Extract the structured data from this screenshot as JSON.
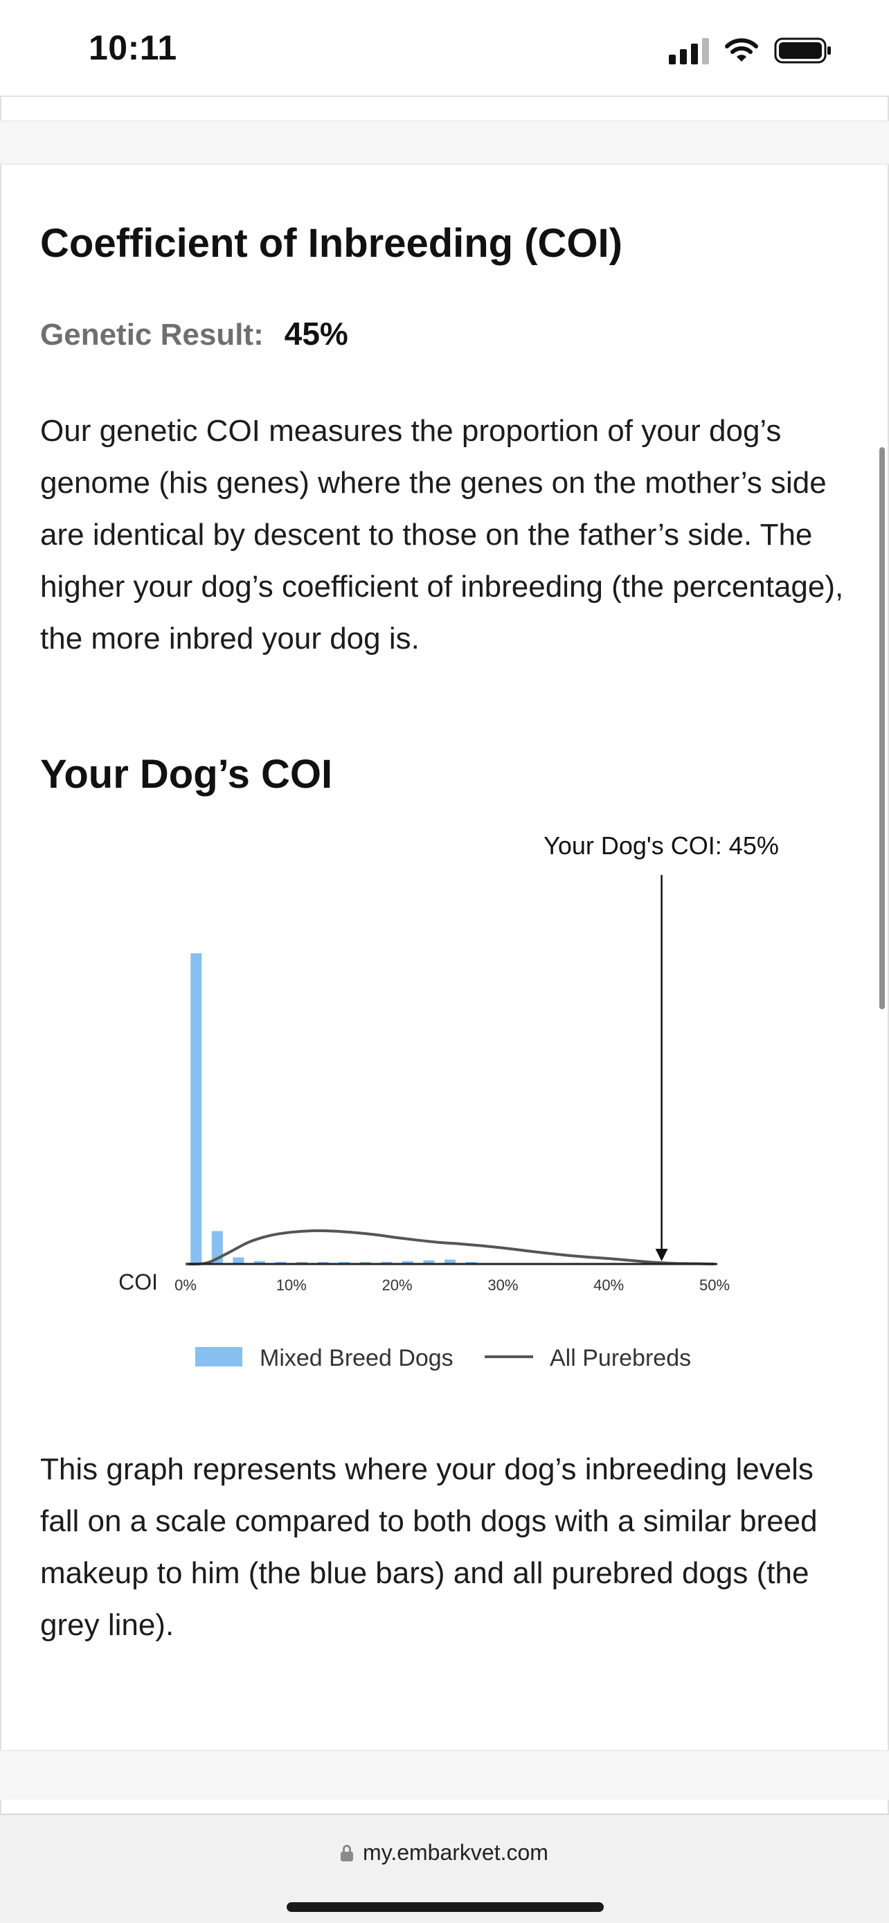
{
  "status": {
    "time": "10:11",
    "icons": [
      "cellular-signal-icon",
      "wifi-icon",
      "battery-icon"
    ]
  },
  "section": {
    "title": "Coefficient of Inbreeding (COI)",
    "result_label": "Genetic Result:",
    "result_value": "45%",
    "description": "Our genetic COI measures the proportion of your dog’s genome (his genes) where the genes on the mother’s side are identical by descent to those on the father’s side. The higher your dog’s coefficient of inbreeding (the percentage), the more inbred your dog is.",
    "subtitle": "Your Dog’s COI",
    "caption": "This graph represents where your dog’s inbreeding levels fall on a scale compared to both dogs with a similar breed makeup to him (the blue bars) and all purebred dogs (the grey line)."
  },
  "chart_data": {
    "type": "bar",
    "xlabel": "COI",
    "xlim": [
      0,
      50
    ],
    "ylim": [
      0,
      1
    ],
    "ticks": [
      "0%",
      "10%",
      "20%",
      "30%",
      "40%",
      "50%"
    ],
    "tick_values": [
      0,
      10,
      20,
      30,
      40,
      50
    ],
    "annotation": {
      "label": "Your Dog's COI: 45%",
      "x": 45
    },
    "legend_position": "bottom",
    "series": [
      {
        "name": "Mixed Breed Dogs",
        "kind": "bar",
        "color": "#86bff0",
        "x": [
          1,
          3,
          5,
          7,
          9,
          11,
          13,
          15,
          17,
          19,
          21,
          23,
          25,
          27
        ],
        "values": [
          0.85,
          0.09,
          0.018,
          0.008,
          0.006,
          0.005,
          0.005,
          0.005,
          0.005,
          0.006,
          0.008,
          0.01,
          0.012,
          0.004
        ]
      },
      {
        "name": "All Purebreds",
        "kind": "line",
        "color": "#555555",
        "x": [
          0,
          2,
          4,
          6,
          8,
          10,
          12,
          14,
          16,
          18,
          20,
          22,
          24,
          26,
          28,
          30,
          32,
          34,
          36,
          38,
          40,
          42,
          44,
          46,
          48,
          50
        ],
        "values": [
          0,
          0.003,
          0.03,
          0.06,
          0.078,
          0.087,
          0.091,
          0.09,
          0.086,
          0.08,
          0.072,
          0.065,
          0.059,
          0.055,
          0.05,
          0.044,
          0.037,
          0.03,
          0.024,
          0.019,
          0.015,
          0.01,
          0.005,
          0.002,
          0.001,
          0
        ]
      }
    ]
  },
  "browser": {
    "url": "my.embarkvet.com"
  }
}
